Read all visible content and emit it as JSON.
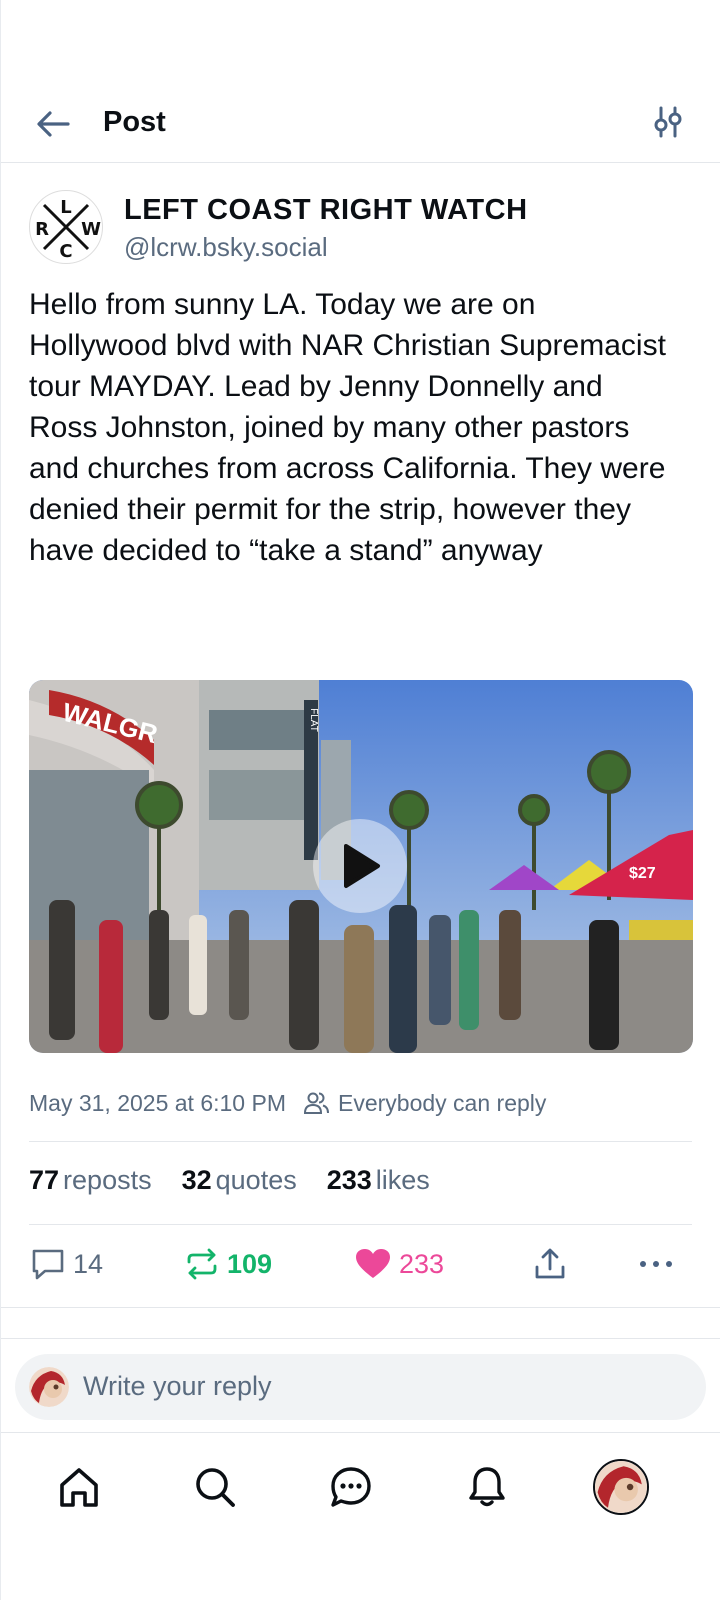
{
  "header": {
    "title": "Post"
  },
  "post": {
    "author_name": "LEFT COAST RIGHT WATCH",
    "author_handle": "@lcrw.bsky.social",
    "avatar_letters": {
      "top": "L",
      "left": "R",
      "right": "W",
      "bottom": "C"
    },
    "text": "Hello from sunny LA. Today we are on Hollywood blvd with NAR Christian Supremacist tour MAYDAY. Lead by Jenny Donnelly and Ross Johnston, joined by many other pastors and churches from across California. They were denied their permit for the strip, however they have decided to “take a stand” anyway",
    "media_signs": {
      "store": "WALGR",
      "hotel": "FLAT",
      "tent": "$27"
    },
    "timestamp": "May 31, 2025 at 6:10 PM",
    "reply_setting": "Everybody can reply"
  },
  "stats": {
    "reposts_count": "77",
    "reposts_label": "reposts",
    "quotes_count": "32",
    "quotes_label": "quotes",
    "likes_count": "233",
    "likes_label": "likes"
  },
  "actions": {
    "replies": "14",
    "reposts": "109",
    "likes": "233"
  },
  "reply": {
    "placeholder": "Write your reply"
  },
  "colors": {
    "accent": "#4a6282",
    "repost": "#13b46a",
    "like": "#ec4899",
    "muted": "#5a6b7f"
  },
  "icons": [
    "back-arrow-icon",
    "filter-icon",
    "comment-icon",
    "repost-icon",
    "heart-icon",
    "share-icon",
    "more-icon",
    "users-icon",
    "home-icon",
    "search-icon",
    "chat-icon",
    "bell-icon"
  ]
}
